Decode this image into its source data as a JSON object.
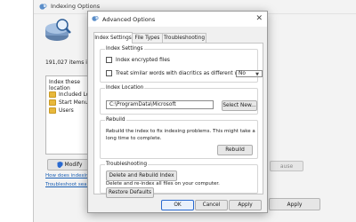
{
  "background_window": {
    "title": "Indexing Options",
    "items_count": "191,027 items index",
    "list_header": "Index these location",
    "locations": [
      "Included Locat",
      "Start Menu",
      "Users"
    ],
    "modify_label": "Modify",
    "pause_label": "ause",
    "apply_label": "Apply",
    "links": [
      "How does indexing affect searches?",
      "Troubleshoot search and indexing"
    ]
  },
  "dialog": {
    "title": "Advanced Options",
    "close_glyph": "✕",
    "tabs": [
      "Index Settings",
      "File Types",
      "Troubleshooting"
    ],
    "active_tab": "Index Settings",
    "index_settings": {
      "group_label": "Index Settings",
      "encrypt_label": "Index encrypted files",
      "diacritics_label": "Treat similar words with diacritics as different words.",
      "diacritics_value": "No"
    },
    "index_location": {
      "group_label": "Index Location",
      "path": "C:\\ProgramData\\Microsoft",
      "select_new_label": "Select New..."
    },
    "rebuild": {
      "group_label": "Rebuild",
      "description": "Rebuild the index to fix indexing problems. This might take a long time to complete.",
      "button_label": "Rebuild"
    },
    "troubleshooting": {
      "group_label": "Troubleshooting",
      "delete_rebuild_label": "Delete and Rebuild Index",
      "restore_text": "Delete and re-index all files on your computer.",
      "restore_label": "Restore Defaults"
    },
    "footer": {
      "ok": "OK",
      "cancel": "Cancel",
      "apply": "Apply"
    }
  },
  "colors": {
    "accent": "#2a6ad0",
    "folder": "#e8b83b",
    "link": "#1a5fb4"
  }
}
